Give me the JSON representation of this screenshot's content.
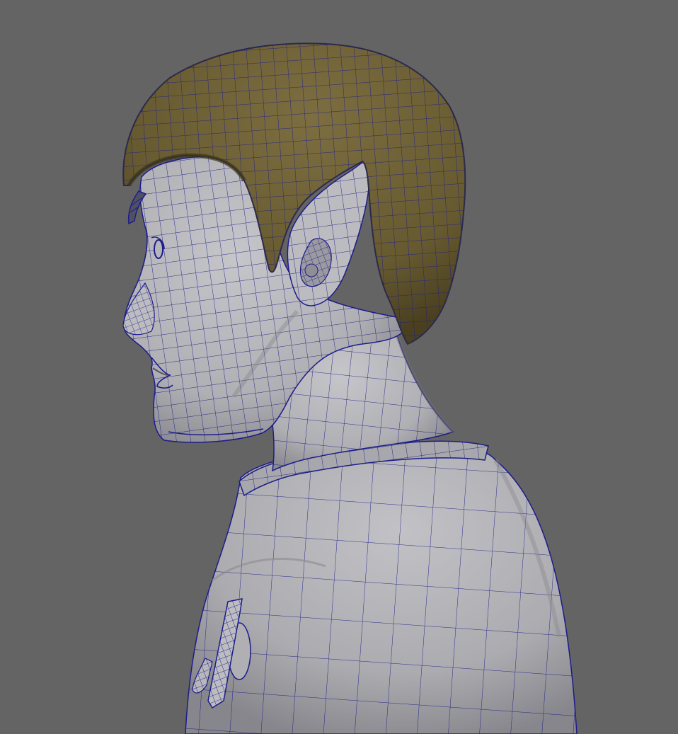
{
  "viewport": {
    "background": "#646464",
    "wireframe_color": "#1c1c8a",
    "skin_color": "#b6b6ba",
    "skin_shadow": "#7c7c82",
    "hair_color": "#6f6238",
    "hair_shadow": "#3c3418",
    "subject": "wireframe-character-bust-side-view"
  }
}
